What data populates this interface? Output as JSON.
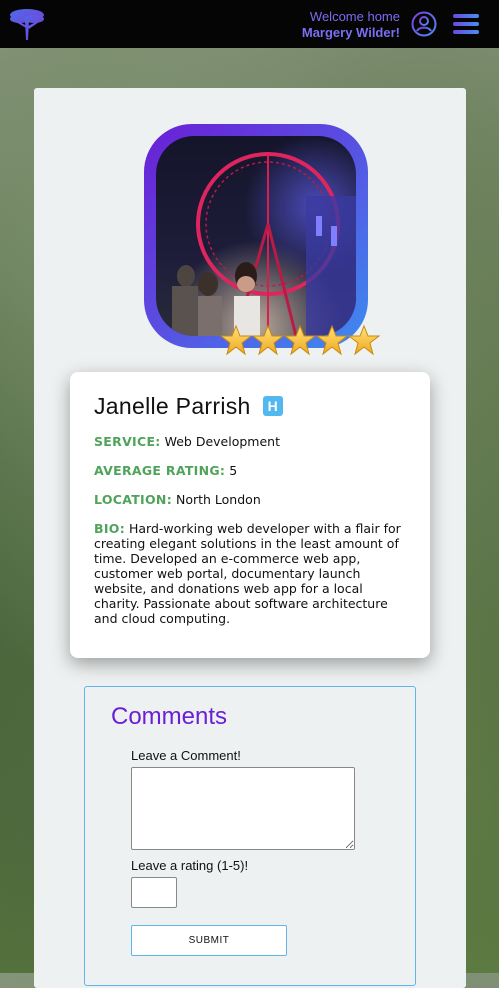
{
  "header": {
    "welcome_text": "Welcome home",
    "user_name": "Margery Wilder!",
    "logo_icon": "tree-logo-icon",
    "user_icon": "user-circle-icon",
    "menu_icon": "hamburger-menu-icon"
  },
  "profile": {
    "photo_alt": "profile-photo",
    "star_rating": 5,
    "name": "Janelle Parrish",
    "badge": "H",
    "service_label": "SERVICE:",
    "service": "Web Development",
    "avg_rating_label": "AVERAGE RATING:",
    "avg_rating": "5",
    "location_label": "LOCATION:",
    "location": "North London",
    "bio_label": "BIO:",
    "bio": "Hard-working web developer with a flair for creating elegant solutions in the least amount of time. Developed an e-commerce web app, customer web portal, documentary launch website, and donations web app for a local charity. Passionate about software architecture and cloud computing."
  },
  "comments": {
    "title": "Comments",
    "comment_label": "Leave a Comment!",
    "comment_value": "",
    "rating_label": "Leave a rating (1-5)!",
    "rating_value": "",
    "submit_label": "SUBMIT"
  },
  "colors": {
    "accent_purple": "#6a1fd6",
    "accent_blue": "#3d8cf0",
    "label_green": "#4fa35a",
    "badge_blue": "#52b8f0",
    "star_gold": "#f5c431"
  }
}
